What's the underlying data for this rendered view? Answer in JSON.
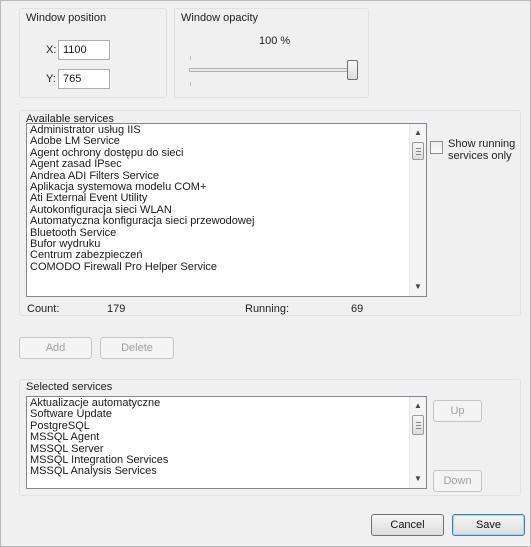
{
  "window_position": {
    "title": "Window position",
    "x_label": "X:",
    "x_value": "1100",
    "y_label": "Y:",
    "y_value": "765"
  },
  "window_opacity": {
    "title": "Window opacity",
    "value_text": "100 %",
    "slider_value_percent": 100
  },
  "available_services": {
    "title": "Available services",
    "items": [
      "Administrator usług IIS",
      "Adobe LM Service",
      "Agent ochrony dostępu do sieci",
      "Agent zasad IPsec",
      "Andrea ADI Filters Service",
      "Aplikacja systemowa modelu COM+",
      "Ati External Event Utility",
      "Autokonfiguracja sieci WLAN",
      "Automatyczna konfiguracja sieci przewodowej",
      "Bluetooth Service",
      "Bufor wydruku",
      "Centrum zabezpieczeń",
      "COMODO Firewall Pro Helper Service"
    ],
    "show_running_label": "Show running services only",
    "show_running_checked": false,
    "count_label": "Count:",
    "count_value": "179",
    "running_label": "Running:",
    "running_value": "69"
  },
  "actions": {
    "add_label": "Add",
    "delete_label": "Delete"
  },
  "selected_services": {
    "title": "Selected services",
    "items": [
      "Aktualizacje automatyczne",
      "Software Update",
      "PostgreSQL",
      "MSSQL Agent",
      "MSSQL Server",
      "MSSQL Integration Services",
      "MSSQL Analysis Services"
    ],
    "up_label": "Up",
    "down_label": "Down"
  },
  "footer": {
    "cancel_label": "Cancel",
    "save_label": "Save"
  }
}
